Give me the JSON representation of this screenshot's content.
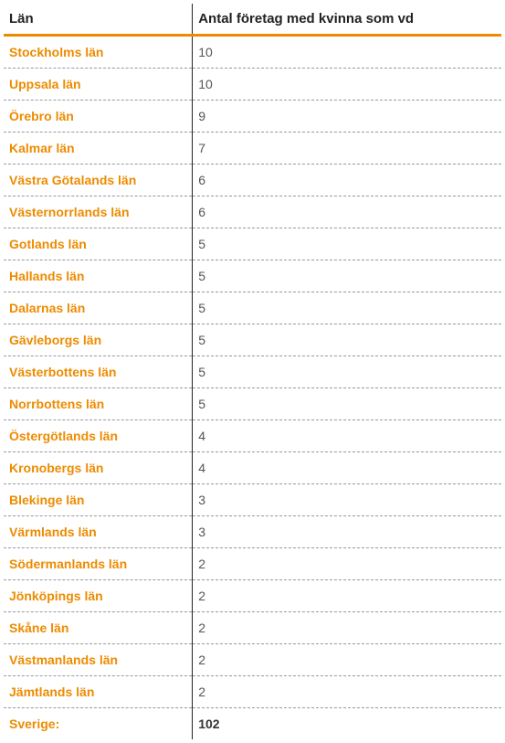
{
  "headers": {
    "county": "Län",
    "value": "Antal företag med kvinna som vd"
  },
  "rows": [
    {
      "county": "Stockholms län",
      "value": 10
    },
    {
      "county": "Uppsala län",
      "value": 10
    },
    {
      "county": "Örebro län",
      "value": 9
    },
    {
      "county": "Kalmar län",
      "value": 7
    },
    {
      "county": "Västra Götalands län",
      "value": 6
    },
    {
      "county": "Västernorrlands län",
      "value": 6
    },
    {
      "county": "Gotlands län",
      "value": 5
    },
    {
      "county": "Hallands län",
      "value": 5
    },
    {
      "county": "Dalarnas län",
      "value": 5
    },
    {
      "county": "Gävleborgs län",
      "value": 5
    },
    {
      "county": "Västerbottens län",
      "value": 5
    },
    {
      "county": "Norrbottens län",
      "value": 5
    },
    {
      "county": "Östergötlands län",
      "value": 4
    },
    {
      "county": "Kronobergs län",
      "value": 4
    },
    {
      "county": "Blekinge län",
      "value": 3
    },
    {
      "county": "Värmlands län",
      "value": 3
    },
    {
      "county": "Södermanlands län",
      "value": 2
    },
    {
      "county": "Jönköpings län",
      "value": 2
    },
    {
      "county": "Skåne län",
      "value": 2
    },
    {
      "county": "Västmanlands län",
      "value": 2
    },
    {
      "county": "Jämtlands län",
      "value": 2
    }
  ],
  "total": {
    "label": "Sverige:",
    "value": 102
  },
  "chart_data": {
    "type": "table",
    "title": "Antal företag med kvinna som vd",
    "columns": [
      "Län",
      "Antal företag med kvinna som vd"
    ],
    "rows": [
      [
        "Stockholms län",
        10
      ],
      [
        "Uppsala län",
        10
      ],
      [
        "Örebro län",
        9
      ],
      [
        "Kalmar län",
        7
      ],
      [
        "Västra Götalands län",
        6
      ],
      [
        "Västernorrlands län",
        6
      ],
      [
        "Gotlands län",
        5
      ],
      [
        "Hallands län",
        5
      ],
      [
        "Dalarnas län",
        5
      ],
      [
        "Gävleborgs län",
        5
      ],
      [
        "Västerbottens län",
        5
      ],
      [
        "Norrbottens län",
        5
      ],
      [
        "Östergötlands län",
        4
      ],
      [
        "Kronobergs län",
        4
      ],
      [
        "Blekinge län",
        3
      ],
      [
        "Värmlands län",
        3
      ],
      [
        "Södermanlands län",
        2
      ],
      [
        "Jönköpings län",
        2
      ],
      [
        "Skåne län",
        2
      ],
      [
        "Västmanlands län",
        2
      ],
      [
        "Jämtlands län",
        2
      ]
    ],
    "total": [
      "Sverige:",
      102
    ]
  }
}
